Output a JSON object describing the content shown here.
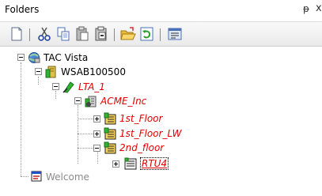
{
  "panel": {
    "title": "Folders",
    "pin_glyph": "ᵽ",
    "close_glyph": "x"
  },
  "toolbar": {
    "buttons": [
      {
        "name": "new-icon"
      },
      {
        "name": "cut-icon"
      },
      {
        "name": "copy-icon"
      },
      {
        "name": "paste-icon"
      },
      {
        "name": "paste-special-icon"
      },
      {
        "name": "open-folder-icon"
      },
      {
        "name": "refresh-icon"
      },
      {
        "name": "properties-icon"
      }
    ]
  },
  "tree": {
    "nodes": [
      {
        "label": "TAC Vista",
        "icon": "vista-globe-icon",
        "style": "normal",
        "expander": "minus"
      },
      {
        "label": "WSAB100500",
        "icon": "server-icon",
        "style": "normal",
        "expander": "minus"
      },
      {
        "label": "LTA_1",
        "icon": "network-icon",
        "style": "red",
        "expander": "minus"
      },
      {
        "label": "ACME_Inc",
        "icon": "building-icon",
        "style": "red",
        "expander": "minus"
      },
      {
        "label": "1st_Floor",
        "icon": "floor-folder-icon",
        "style": "red",
        "expander": "plus"
      },
      {
        "label": "1st_Floor_LW",
        "icon": "floor-folder-icon",
        "style": "red",
        "expander": "plus"
      },
      {
        "label": "2nd_floor",
        "icon": "floor-folder-icon",
        "style": "red",
        "expander": "minus"
      },
      {
        "label": "RTU4",
        "icon": "device-icon",
        "style": "red-selected",
        "expander": "plus"
      },
      {
        "label": "Welcome",
        "icon": "welcome-icon",
        "style": "grey",
        "expander": "none"
      }
    ]
  },
  "colors": {
    "offline_text": "#e00000",
    "disabled_text": "#8a8a8a",
    "folder_yellow": "#f5d35a",
    "accent_green": "#2fb52f"
  }
}
